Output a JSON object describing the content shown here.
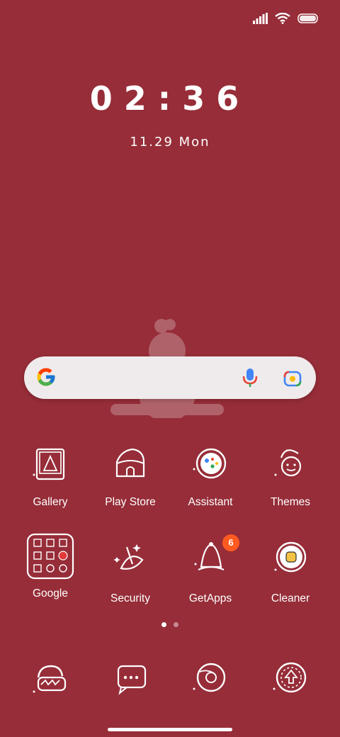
{
  "status_bar": {
    "signal_icon": "signal-icon",
    "wifi_icon": "wifi-icon",
    "battery_icon": "battery-icon"
  },
  "lock": {
    "time": "02:36",
    "date": "11.29 Mon"
  },
  "search": {
    "google_icon": "google-g-icon",
    "mic_icon": "mic-icon",
    "lens_icon": "lens-icon"
  },
  "apps_row1": [
    {
      "label": "Gallery",
      "icon": "gallery-icon"
    },
    {
      "label": "Play Store",
      "icon": "play-store-icon"
    },
    {
      "label": "Assistant",
      "icon": "assistant-icon"
    },
    {
      "label": "Themes",
      "icon": "themes-icon"
    }
  ],
  "apps_row2": [
    {
      "label": "Google",
      "icon": "google-folder-icon"
    },
    {
      "label": "Security",
      "icon": "security-icon"
    },
    {
      "label": "GetApps",
      "icon": "getapps-icon",
      "badge": "6"
    },
    {
      "label": "Cleaner",
      "icon": "cleaner-icon"
    }
  ],
  "dock": [
    {
      "icon": "phone-icon"
    },
    {
      "icon": "messages-icon"
    },
    {
      "icon": "browser-icon"
    },
    {
      "icon": "camera-icon"
    }
  ],
  "colors": {
    "background": "#962d38",
    "badge": "#ff5a1f",
    "search_bg": "#efebec"
  }
}
